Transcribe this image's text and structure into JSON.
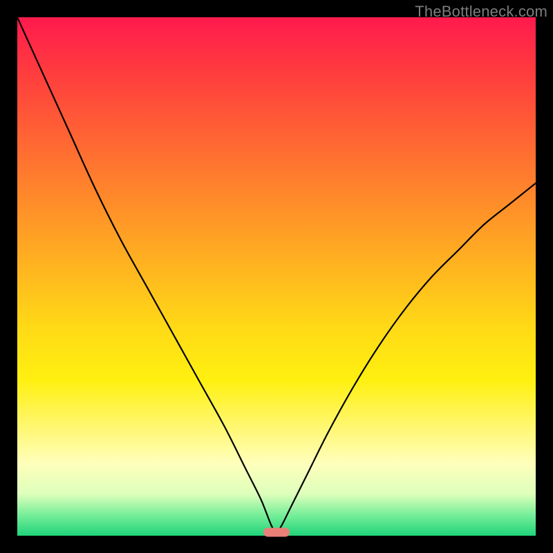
{
  "watermark": "TheBottleneck.com",
  "colors": {
    "background": "#000000",
    "curve_stroke": "#000000",
    "marker_fill": "#e98077",
    "watermark_text": "#7d7d7d"
  },
  "chart_data": {
    "type": "line",
    "title": "",
    "xlabel": "",
    "ylabel": "",
    "xlim": [
      0,
      100
    ],
    "ylim": [
      0,
      100
    ],
    "grid": false,
    "legend": false,
    "series": [
      {
        "name": "bottleneck-curve",
        "x": [
          0,
          5,
          10,
          15,
          20,
          25,
          30,
          35,
          40,
          44,
          47,
          49,
          50,
          51,
          53,
          56,
          60,
          65,
          70,
          75,
          80,
          85,
          90,
          95,
          100
        ],
        "y": [
          100,
          89,
          78,
          67,
          57,
          48,
          39,
          30,
          21,
          13,
          7,
          2,
          0.7,
          2,
          6,
          12,
          20,
          29,
          37,
          44,
          50,
          55,
          60,
          64,
          68
        ]
      }
    ],
    "marker": {
      "x": 50,
      "y": 0.7
    },
    "background_gradient": {
      "top": "#ff1a4d",
      "middle": "#fff010",
      "bottom": "#1fd47a"
    }
  }
}
